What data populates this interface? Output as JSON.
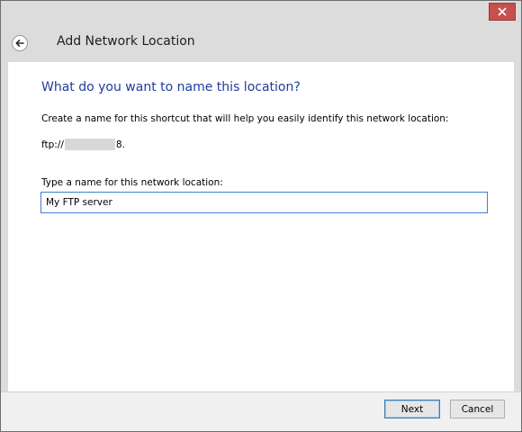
{
  "window": {
    "title": "Add Network Location",
    "close_icon": "close-icon",
    "back_icon": "back-arrow-icon",
    "close_color": "#c75050"
  },
  "page": {
    "heading": "What do you want to name this location?",
    "description": "Create a name for this shortcut that will help you easily identify this network location:",
    "address_prefix": "ftp://",
    "address_suffix": "8.",
    "field_label": "Type a name for this network location:",
    "name_value": "My FTP server"
  },
  "buttons": {
    "next_label": "Next",
    "cancel_label": "Cancel"
  },
  "colors": {
    "heading": "#1f3d9e",
    "input_border": "#3d7fcf"
  }
}
